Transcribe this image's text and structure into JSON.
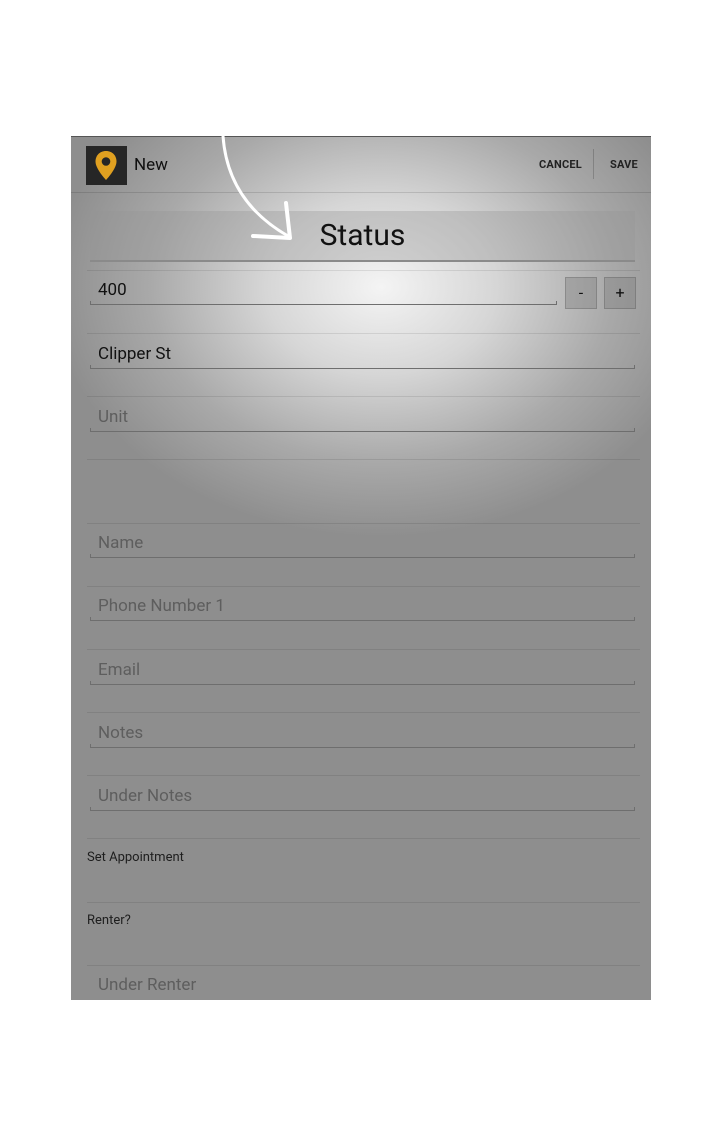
{
  "actionbar": {
    "title": "New",
    "cancel": "CANCEL",
    "save": "SAVE",
    "app_icon": "map-pin-icon",
    "accent": "#e0a020"
  },
  "status_button": "Status",
  "number_field": {
    "value": "400",
    "minus": "-",
    "plus": "+"
  },
  "street_field": {
    "value": "Clipper St"
  },
  "fields": [
    {
      "placeholder": "Unit"
    },
    {
      "placeholder": "Name"
    },
    {
      "placeholder": "Phone Number 1"
    },
    {
      "placeholder": "Email"
    },
    {
      "placeholder": "Notes"
    },
    {
      "placeholder": "Under Notes"
    },
    {
      "placeholder": "Under Renter"
    }
  ],
  "labels": {
    "set_appointment": "Set Appointment",
    "renter": "Renter?"
  }
}
